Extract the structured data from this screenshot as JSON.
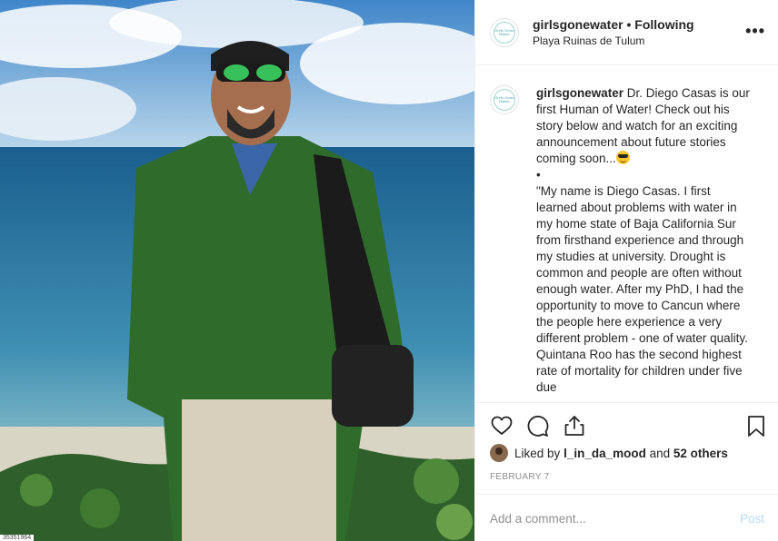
{
  "photo": {
    "corner_label": "35351964"
  },
  "header": {
    "avatar_text": "Girls Gone Water",
    "username": "girlsgonewater",
    "separator": "•",
    "follow_status": "Following",
    "location": "Playa Ruinas de Tulum",
    "more_label": "•••"
  },
  "caption": {
    "username": "girlsgonewater",
    "text_intro": "Dr. Diego Casas is our first Human of Water! Check out his story below and watch for an exciting announcement about future stories coming soon...",
    "emoji": "smiling-face-with-sunglasses",
    "bullet": "•",
    "quote": "\"My name is Diego Casas. I first learned about problems with water in my home state of Baja California Sur from firsthand experience and through my studies at university. Drought is common and people are often without enough water. After my PhD, I had the opportunity to move to Cancun where the people here experience a very different problem - one of water quality. Quintana Roo has the second highest rate of mortality for children under five due"
  },
  "actions": {
    "like_icon": "heart-icon",
    "comment_icon": "comment-icon",
    "share_icon": "share-icon",
    "save_icon": "bookmark-icon"
  },
  "likes": {
    "prefix": "Liked by",
    "user": "l_in_da_mood",
    "connector": "and",
    "others": "52 others"
  },
  "date": "FEBRUARY 7",
  "comment": {
    "placeholder": "Add a comment...",
    "post_label": "Post"
  },
  "colors": {
    "border": "#efefef",
    "text": "#262626",
    "muted": "#8e8e8e",
    "post_disabled": "#b3dbff"
  }
}
